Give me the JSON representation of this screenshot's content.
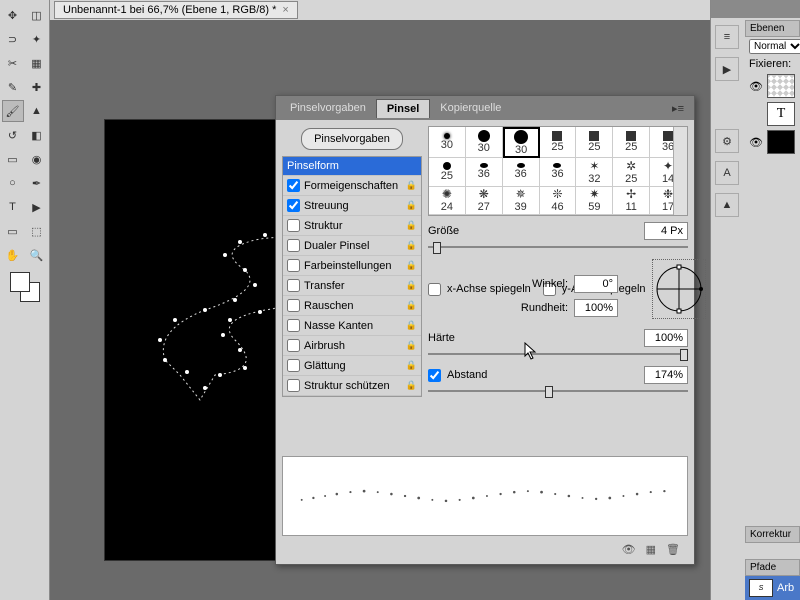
{
  "titlebar": {
    "doc_title": "Unbenannt-1 bei 66,7% (Ebene 1, RGB/8) *"
  },
  "brush_panel": {
    "tabs": {
      "presets": "Pinselvorgaben",
      "brush": "Pinsel",
      "clone": "Kopierquelle"
    },
    "btn_presets": "Pinselvorgaben",
    "options": {
      "pinselform": "Pinselform",
      "formeigenschaften": "Formeigenschaften",
      "streuung": "Streuung",
      "struktur": "Struktur",
      "dualer": "Dualer Pinsel",
      "farbeinstellungen": "Farbeinstellungen",
      "transfer": "Transfer",
      "rauschen": "Rauschen",
      "nasse": "Nasse Kanten",
      "airbrush": "Airbrush",
      "glaettung": "Glättung",
      "struktur_schuetzen": "Struktur schützen"
    },
    "checked": {
      "formeigenschaften": true,
      "streuung": true
    },
    "tips": [
      30,
      30,
      30,
      25,
      25,
      25,
      36,
      25,
      36,
      36,
      36,
      32,
      25,
      14,
      24,
      27,
      39,
      46,
      59,
      11,
      17
    ],
    "size_label": "Größe",
    "size_value": "4 Px",
    "flip_x": "x-Achse spiegeln",
    "flip_y": "y-Achse spiegeln",
    "angle_label": "Winkel:",
    "angle_value": "0°",
    "roundness_label": "Rundheit:",
    "roundness_value": "100%",
    "hardness_label": "Härte",
    "hardness_value": "100%",
    "spacing_label": "Abstand",
    "spacing_value": "174%"
  },
  "right_dock": {
    "ebenen_title": "Ebenen",
    "mode": "Normal",
    "fixieren": "Fixieren:",
    "korrekturen": "Korrektur",
    "pfade": "Pfade",
    "path_name": "Arb"
  }
}
